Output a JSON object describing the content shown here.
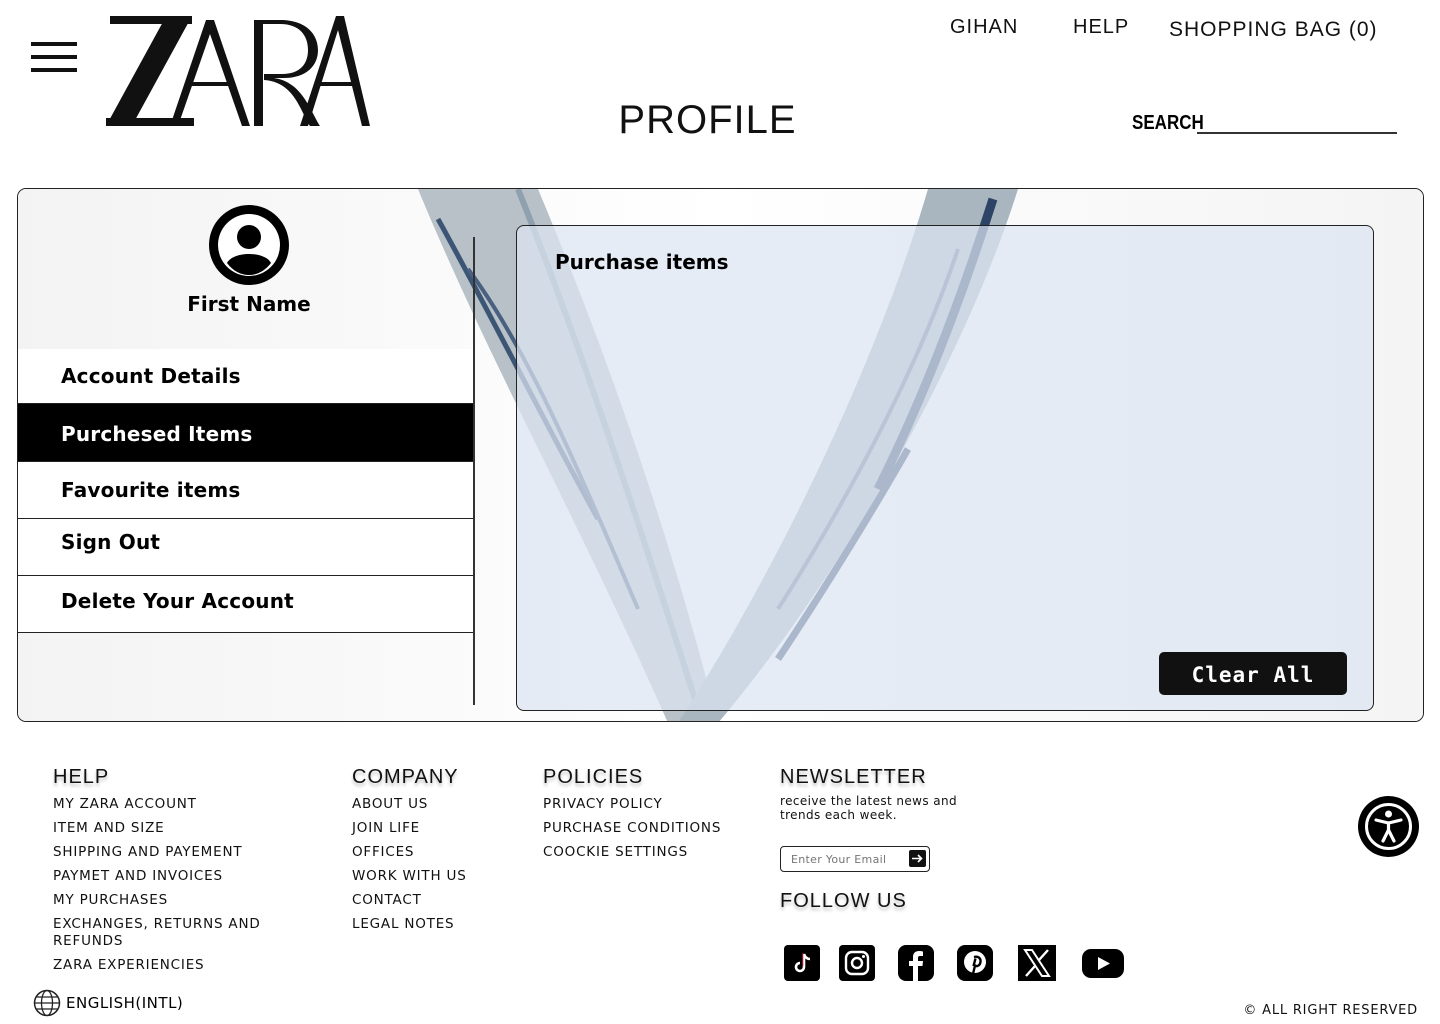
{
  "header": {
    "brand": "ZARA",
    "nav_user": "GIHAN",
    "nav_help": "HELP",
    "nav_bag": "SHOPPING BAG (0)",
    "page_title": "PROFILE",
    "search_label": "SEARCH",
    "search_value": ""
  },
  "profile": {
    "name": "First Name",
    "menu": [
      {
        "label": "Account Details",
        "active": false
      },
      {
        "label": "Purchesed Items",
        "active": true
      },
      {
        "label": "Favourite items",
        "active": false
      },
      {
        "label": "Sign Out",
        "active": false
      },
      {
        "label": "Delete Your Account",
        "active": false
      }
    ],
    "content_title": "Purchase items",
    "clear_label": "Clear All"
  },
  "footer": {
    "help": {
      "heading": "HELP",
      "links": [
        "MY ZARA ACCOUNT",
        "ITEM AND SIZE",
        "SHIPPING AND PAYEMENT",
        "PAYMET AND INVOICES",
        "MY PURCHASES",
        "EXCHANGES, RETURNS AND REFUNDS",
        "ZARA EXPERIENCIES"
      ]
    },
    "company": {
      "heading": "COMPANY",
      "links": [
        "ABOUT US",
        "JOIN LIFE",
        "OFFICES",
        "WORK WITH US",
        "CONTACT",
        "LEGAL NOTES"
      ]
    },
    "policies": {
      "heading": "POLICIES",
      "links": [
        "PRIVACY POLICY",
        "PURCHASE CONDITIONS",
        "COOCKIE SETTINGS"
      ]
    },
    "newsletter": {
      "heading": "NEWSLETTER",
      "description": "receive the latest news and trends each week.",
      "email_placeholder": "Enter Your Email"
    },
    "follow_heading": "FOLLOW US",
    "socials": [
      "tiktok-icon",
      "instagram-icon",
      "facebook-icon",
      "pinterest-icon",
      "x-icon",
      "youtube-icon"
    ],
    "language": "ENGLISH(INTL)",
    "copyright": "© ALL RIGHT RESERVED"
  },
  "colors": {
    "primary": "#000000",
    "panel_bg": "#f2f2f2",
    "content_bg": "#dce4f2",
    "scarf_accent": "#3d5575"
  }
}
